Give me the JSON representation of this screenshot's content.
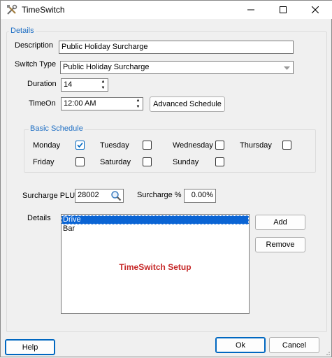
{
  "window": {
    "title": "TimeSwitch",
    "app_icon": "tools-icon",
    "minimize_icon": "minimize-icon",
    "maximize_icon": "maximize-icon",
    "close_icon": "close-icon"
  },
  "details_group": {
    "legend": "Details",
    "description_label": "Description",
    "description_value": "Public Holiday Surcharge",
    "switch_type_label": "Switch Type",
    "switch_type_value": "Public Holiday Surcharge",
    "duration_label": "Duration",
    "duration_value": "14",
    "timeon_label": "TimeOn",
    "timeon_value": "12:00 AM",
    "advanced_schedule_label": "Advanced Schedule"
  },
  "basic_schedule": {
    "legend": "Basic Schedule",
    "days": [
      {
        "label": "Monday",
        "checked": true
      },
      {
        "label": "Tuesday",
        "checked": false
      },
      {
        "label": "Wednesday",
        "checked": false
      },
      {
        "label": "Thursday",
        "checked": false
      },
      {
        "label": "Friday",
        "checked": false
      },
      {
        "label": "Saturday",
        "checked": false
      },
      {
        "label": "Sunday",
        "checked": false
      }
    ]
  },
  "surcharge": {
    "plu_label": "Surcharge PLU",
    "plu_value": "28002",
    "search_icon": "search-icon",
    "percent_label": "Surcharge %",
    "percent_value": "0.00%"
  },
  "details_list": {
    "label": "Details",
    "items": [
      "Drive",
      "Bar"
    ],
    "selected_index": 0,
    "watermark": "TimeSwitch Setup",
    "add_label": "Add",
    "remove_label": "Remove"
  },
  "footer": {
    "help_label": "Help",
    "ok_label": "Ok",
    "cancel_label": "Cancel"
  },
  "colors": {
    "accent": "#0067c0",
    "legend": "#1f6fc4",
    "watermark": "#c62828",
    "selection": "#0a64d4"
  }
}
